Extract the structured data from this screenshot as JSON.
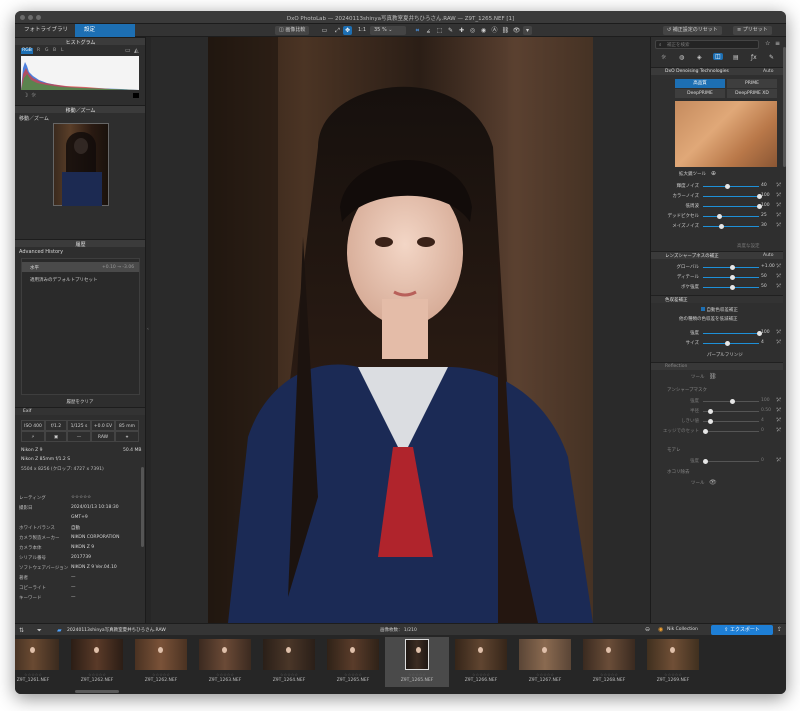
{
  "window": {
    "title": "DxO PhotoLab — 20240113shinya写真教室夏井ちひろさん.RAW — Z9T_1265.NEF [1]"
  },
  "toolbar": {
    "tab_library": "フォトライブラリ",
    "tab_customize": "設定",
    "compare": "画像比較",
    "zoom_ratio": "1:1",
    "zoom_value": "35 %",
    "reset_label": "補正設定のリセット",
    "presets_label": "プリセット"
  },
  "left": {
    "histogram_title": "ヒストグラム",
    "histogram_channels": [
      "RGB",
      "R",
      "G",
      "B",
      "L"
    ],
    "move_zoom_title": "移動／ズーム",
    "move_zoom_sub": "移動／ズーム",
    "history_title": "履歴",
    "history_sub": "Advanced History",
    "history_items": [
      {
        "label": "水平",
        "value": "+0.10 → -3.06"
      },
      {
        "label": "適用済みのデフォルトプリセット",
        "value": ""
      }
    ],
    "history_clear": "履歴をクリア",
    "exif_title": "Exif",
    "exif_cells": [
      "ISO 400",
      "f/1.2",
      "1/125 s",
      "+0.0 EV",
      "85 mm",
      "—",
      "RAW"
    ],
    "camera": "Nikon Z 9",
    "file_size": "50.4 MB",
    "lens": "Nikon Z 85mm f/1.2 S",
    "dimensions": "5504 x 8256 (クロップ: 4727 x 7391)",
    "meta": [
      {
        "k": "レーティング",
        "v": "☆☆☆☆☆"
      },
      {
        "k": "撮影日",
        "v": "2024/01/13 10:18:30"
      },
      {
        "k": "",
        "v": "GMT+9"
      },
      {
        "k": "ホワイトバランス",
        "v": "自動"
      },
      {
        "k": "カメラ製造メーカー",
        "v": "NIKON CORPORATION"
      },
      {
        "k": "カメラ本体",
        "v": "NIKON Z 9"
      },
      {
        "k": "シリアル番号",
        "v": "2017739"
      },
      {
        "k": "ソフトウェアバージョン",
        "v": "NIKON Z 9 Ver.04.10"
      },
      {
        "k": "著者",
        "v": "—"
      },
      {
        "k": "コピーライト",
        "v": "—"
      },
      {
        "k": "キーワード",
        "v": "—"
      }
    ]
  },
  "right": {
    "search_placeholder": "補正を検索",
    "denoise_title": "DxO Denoising Technologies",
    "denoise_mode": "Auto",
    "quality_label": "高品質",
    "prime_label": "PRIME",
    "deepprime_label": "DeepPRIME",
    "deepprimexd_label": "DeepPRIME XD",
    "magnifier_label": "拡大鏡ツール",
    "denoise_sliders": [
      {
        "label": "輝度ノイズ",
        "value": "40",
        "pos": 0.4
      },
      {
        "label": "カラーノイズ",
        "value": "100",
        "pos": 1.0
      },
      {
        "label": "低周波",
        "value": "100",
        "pos": 1.0
      },
      {
        "label": "デッドピクセル",
        "value": "25",
        "pos": 0.25
      },
      {
        "label": "メイズノイズ",
        "value": "30",
        "pos": 0.3
      }
    ],
    "advanced_label": "高度な設定",
    "lens_title": "レンズシャープネスの補正",
    "lens_mode": "Auto",
    "lens_sliders": [
      {
        "label": "グローバル",
        "value": "+1.00",
        "pos": 0.5
      },
      {
        "label": "ディテール",
        "value": "50",
        "pos": 0.5
      },
      {
        "label": "ボケ強度",
        "value": "50",
        "pos": 0.5
      }
    ],
    "chroma_title": "色収差補正",
    "chroma_auto": "自動色収差補正",
    "chroma_other": "他の種類の色収差を低減補正",
    "chroma_sliders": [
      {
        "label": "強度",
        "value": "100",
        "pos": 1.0
      },
      {
        "label": "サイズ",
        "value": "4",
        "pos": 0.4
      }
    ],
    "purple_label": "パープルフリンジ",
    "moire_title": "Reflection",
    "moire_tool": "ツール",
    "unsharp_title": "アンシャープマスク",
    "unsharp_sliders": [
      {
        "label": "強度",
        "value": "100",
        "pos": 0.5
      },
      {
        "label": "半径",
        "value": "0.50",
        "pos": 0.1
      },
      {
        "label": "しきい値",
        "value": "4",
        "pos": 0.1
      },
      {
        "label": "エッジでのセット",
        "value": "0",
        "pos": 0.0
      }
    ],
    "moire2_title": "モアレ",
    "moire2_slider": {
      "label": "強度",
      "value": "0",
      "pos": 0.0
    },
    "dust_title": "ホコリ除去",
    "dust_tool": "ツール"
  },
  "filmbar": {
    "folder": "20240113shinya写真教室夏井ちひろさん.RAW",
    "count": "画像枚数： 1/210",
    "nik": "Nik Collection",
    "export": "エクスポート"
  },
  "thumbs": [
    {
      "name": "Z9T_1261.NEF"
    },
    {
      "name": "Z9T_1262.NEF"
    },
    {
      "name": "Z9T_1262.NEF"
    },
    {
      "name": "Z9T_1263.NEF"
    },
    {
      "name": "Z9T_1264.NEF"
    },
    {
      "name": "Z9T_1265.NEF"
    },
    {
      "name": "Z9T_1265.NEF"
    },
    {
      "name": "Z9T_1266.NEF"
    },
    {
      "name": "Z9T_1267.NEF"
    },
    {
      "name": "Z9T_1268.NEF"
    },
    {
      "name": "Z9T_1269.NEF"
    }
  ],
  "colors": {
    "accent": "#1e88e5",
    "panel": "#2f2f2f",
    "export_button": "#1e7fd6"
  }
}
